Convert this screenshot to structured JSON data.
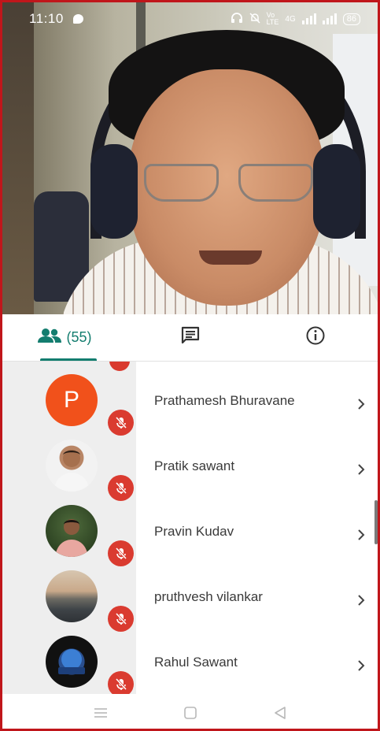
{
  "status_bar": {
    "time": "11:10",
    "net_label": "4G",
    "battery": "86"
  },
  "tabs": [
    {
      "icon": "people-icon",
      "label": "(55)",
      "active": true
    },
    {
      "icon": "chat-icon",
      "label": "",
      "active": false
    },
    {
      "icon": "info-icon",
      "label": "",
      "active": false
    }
  ],
  "participants": [
    {
      "name": "Prathamesh Bhuravane",
      "avatar_type": "letter",
      "avatar_letter": "P",
      "muted": true
    },
    {
      "name": "Pratik sawant",
      "avatar_type": "photo",
      "muted": true
    },
    {
      "name": "Pravin Kudav",
      "avatar_type": "photo",
      "muted": true
    },
    {
      "name": "pruthvesh vilankar",
      "avatar_type": "photo",
      "muted": true
    },
    {
      "name": "Rahul Sawant",
      "avatar_type": "photo",
      "muted": true
    }
  ],
  "colors": {
    "accent": "#137d6f",
    "mute_badge": "#da3b30",
    "letter_avatar": "#f1511b",
    "frame_border": "#c0161b"
  },
  "navbar": [
    "menu-icon",
    "home-icon",
    "back-icon"
  ]
}
